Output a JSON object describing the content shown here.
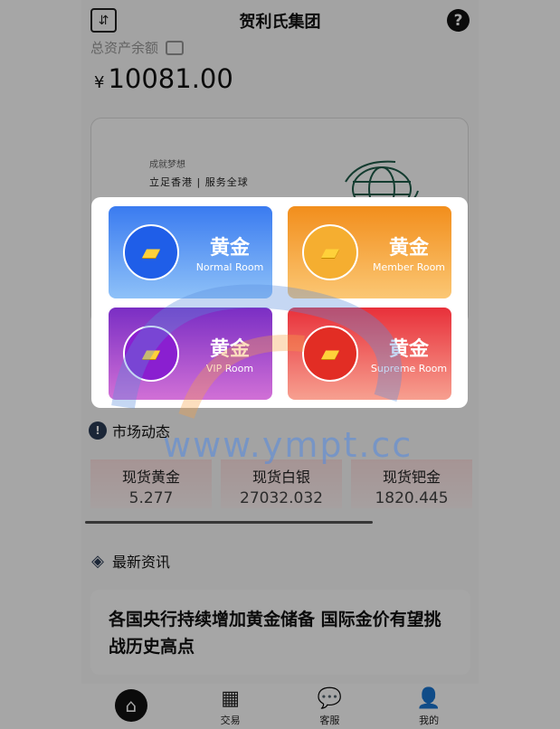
{
  "header": {
    "title": "贺利氏集团",
    "help_glyph": "?"
  },
  "asset": {
    "label": "总资产余额",
    "currency": "¥",
    "amount": "10081.00"
  },
  "banner": {
    "subtitle": "成就梦想",
    "slogan": "立足香港 | 服务全球"
  },
  "market": {
    "title": "市场动态",
    "items": [
      {
        "name": "现货黄金",
        "price": "5.277"
      },
      {
        "name": "现货白银",
        "price": "27032.032"
      },
      {
        "name": "现货钯金",
        "price": "1820.445"
      }
    ]
  },
  "news": {
    "title": "最新资讯",
    "headline": "各国央行持续增加黄金储备 国际金价有望挑战历史高点"
  },
  "tabbar": {
    "items": [
      {
        "label": "",
        "icon": "home-icon"
      },
      {
        "label": "交易",
        "icon": "grid-icon"
      },
      {
        "label": "客服",
        "icon": "chat-icon"
      },
      {
        "label": "我的",
        "icon": "user-icon"
      }
    ]
  },
  "modal": {
    "rooms": [
      {
        "cn": "黄金",
        "en": "Normal Room",
        "color": "#3a7bf0"
      },
      {
        "cn": "黄金",
        "en": "Member Room",
        "color": "#f28e1c"
      },
      {
        "cn": "黄金",
        "en": "VIP Room",
        "color": "#7a2ec4"
      },
      {
        "cn": "黄金",
        "en": "Supreme Room",
        "color": "#e8303a"
      }
    ]
  },
  "watermark": {
    "text": "www.ympt.cc"
  }
}
